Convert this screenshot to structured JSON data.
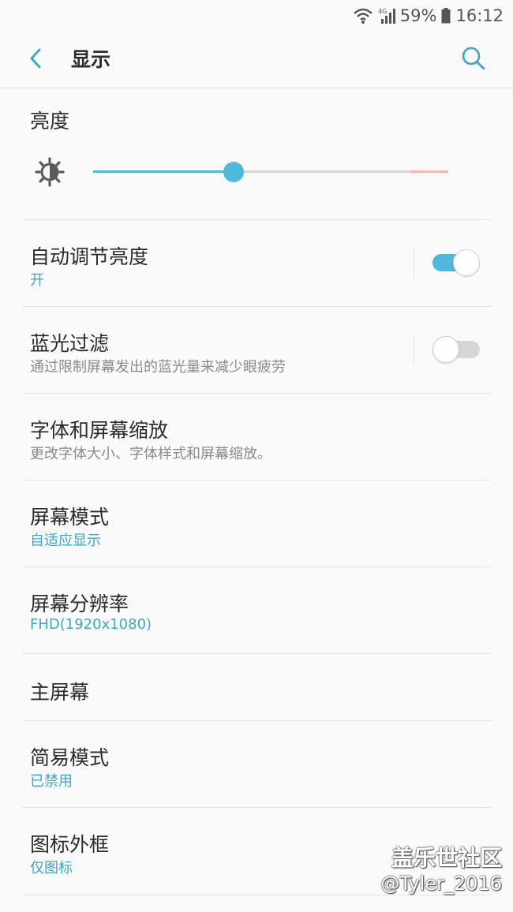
{
  "status": {
    "battery_percent": "59%",
    "time": "16:12",
    "network": "4G"
  },
  "header": {
    "title": "显示"
  },
  "brightness": {
    "title": "亮度",
    "level_fraction": 0.395
  },
  "items": [
    {
      "title": "自动调节亮度",
      "subtitle": "开",
      "toggle": true
    },
    {
      "title": "蓝光过滤",
      "subtitle": "通过限制屏幕发出的蓝光量来减少眼疲劳",
      "toggle": false
    },
    {
      "title": "字体和屏幕缩放",
      "subtitle": "更改字体大小、字体样式和屏幕缩放。"
    },
    {
      "title": "屏幕模式",
      "subtitle": "自适应显示"
    },
    {
      "title": "屏幕分辨率",
      "subtitle": "FHD(1920x1080)"
    },
    {
      "title": "主屏幕"
    },
    {
      "title": "简易模式",
      "subtitle": "已禁用"
    },
    {
      "title": "图标外框",
      "subtitle": "仅图标"
    }
  ],
  "watermark": {
    "line1": "盖乐世社区",
    "line2": "@Tyler_2016"
  },
  "colors": {
    "accent": "#4fb8dc",
    "subtitle_accent": "#3ea6c8",
    "divider": "#e4e4e4"
  },
  "icons": [
    "wifi-icon",
    "signal-icon",
    "battery-icon",
    "back-arrow-icon",
    "search-icon",
    "brightness-sun-icon"
  ]
}
